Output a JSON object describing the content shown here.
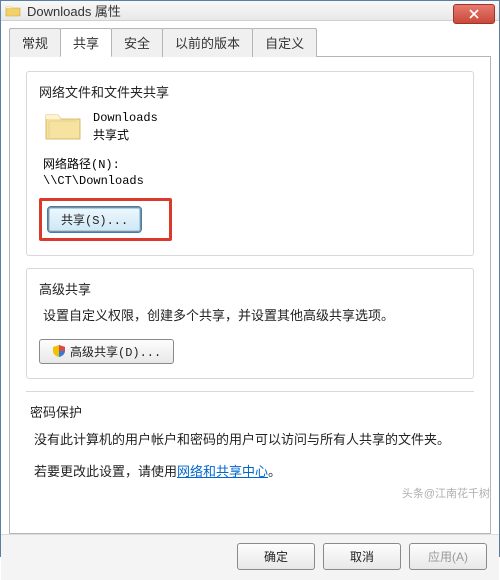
{
  "window": {
    "title": "Downloads 属性",
    "close_label": "X"
  },
  "tabs": {
    "general": "常规",
    "sharing": "共享",
    "security": "安全",
    "previous": "以前的版本",
    "custom": "自定义"
  },
  "network_sharing": {
    "title": "网络文件和文件夹共享",
    "folder_name": "Downloads",
    "status": "共享式",
    "path_label": "网络路径(N):",
    "path_value": "\\\\CT\\Downloads",
    "share_button": "共享(S)..."
  },
  "advanced_sharing": {
    "title": "高级共享",
    "description": "设置自定义权限，创建多个共享，并设置其他高级共享选项。",
    "button": "高级共享(D)..."
  },
  "password_protection": {
    "title": "密码保护",
    "line1": "没有此计算机的用户帐户和密码的用户可以访问与所有人共享的文件夹。",
    "line2_prefix": "若要更改此设置，请使用",
    "link_text": "网络和共享中心",
    "line2_suffix": "。"
  },
  "footer": {
    "ok": "确定",
    "cancel": "取消",
    "apply": "应用(A)"
  },
  "watermark": "头条@江南花千树"
}
